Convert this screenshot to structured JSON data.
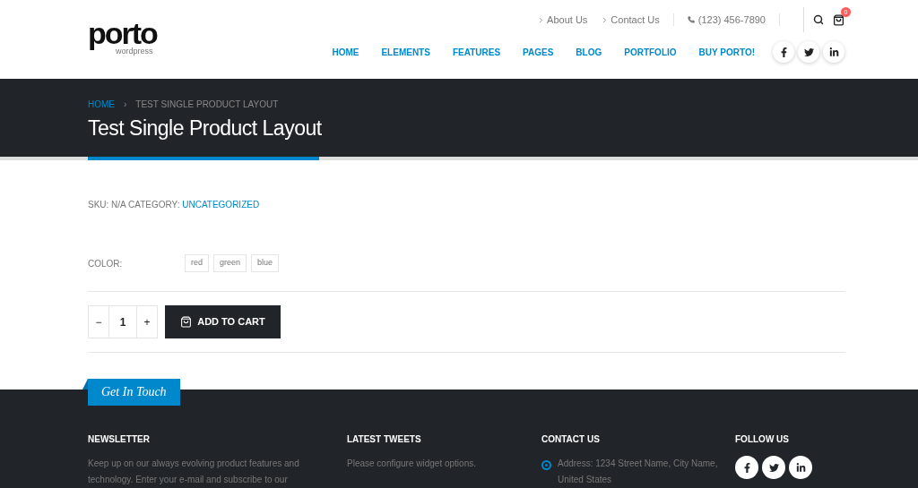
{
  "logo": {
    "name": "porto",
    "tagline": "wordpress"
  },
  "top_links": [
    {
      "label": "About Us"
    },
    {
      "label": "Contact Us"
    }
  ],
  "phone": "(123) 456-7890",
  "cart": {
    "count": "0"
  },
  "nav": [
    "HOME",
    "ELEMENTS",
    "FEATURES",
    "PAGES",
    "BLOG",
    "PORTFOLIO",
    "BUY PORTO!"
  ],
  "breadcrumb": {
    "home": "HOME",
    "separator": "›",
    "current": "TEST SINGLE PRODUCT LAYOUT"
  },
  "page_title": "Test Single Product Layout",
  "meta": {
    "sku": "SKU: N/A CATEGORY:",
    "category": "UNCATEGORIZED"
  },
  "color_option": {
    "label": "COLOR:",
    "choices": [
      "red",
      "green",
      "blue"
    ]
  },
  "quantity": {
    "minus": "−",
    "value": "1",
    "plus": "+"
  },
  "add_to_cart": "ADD TO CART",
  "footer": {
    "ribbon": "Get In Touch",
    "columns": [
      {
        "kind": "text",
        "title": "NEWSLETTER",
        "text": "Keep up on our always evolving product features and technology. Enter your e-mail and subscribe to our"
      },
      {
        "kind": "text",
        "title": "LATEST TWEETS",
        "text": "Please configure widget options."
      },
      {
        "kind": "contact",
        "title": "CONTACT US",
        "text": "Address: 1234 Street Name, City Name, United States"
      },
      {
        "kind": "social",
        "title": "FOLLOW US"
      }
    ]
  }
}
